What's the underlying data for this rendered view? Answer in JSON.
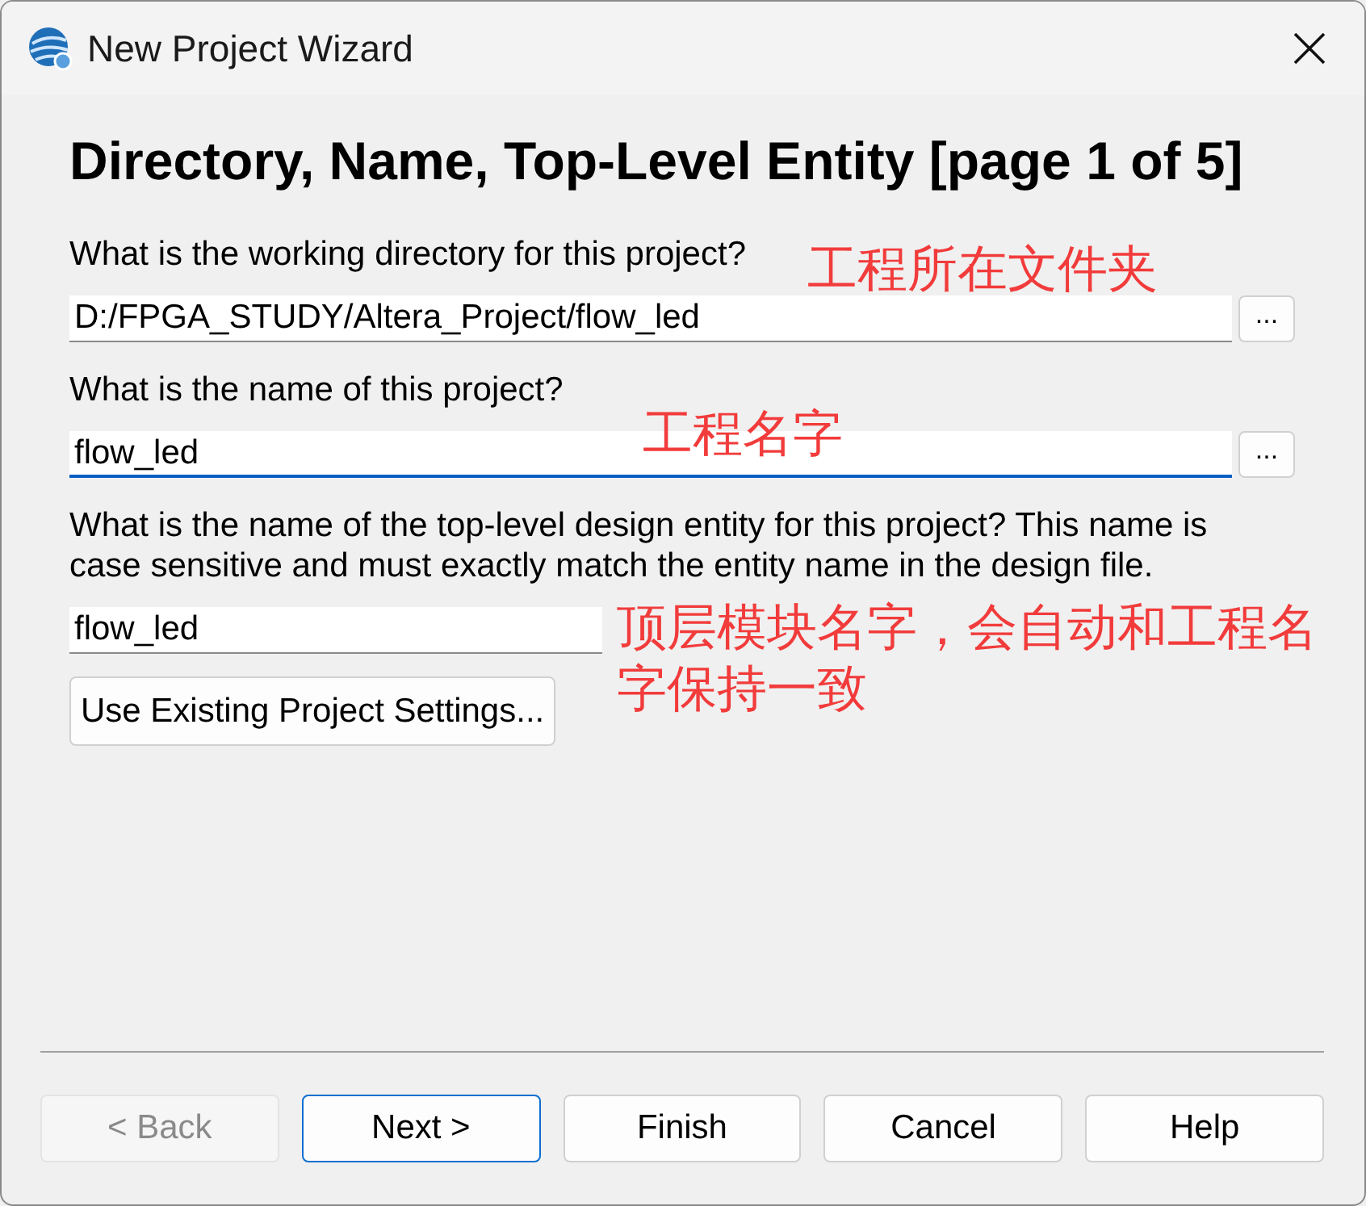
{
  "window": {
    "title": "New Project Wizard"
  },
  "heading": "Directory, Name, Top-Level Entity [page 1 of 5]",
  "fields": [
    {
      "label": "What is the working directory for this project?",
      "value": "D:/FPGA_STUDY/Altera_Project/flow_led",
      "focused": false,
      "browse": "..."
    },
    {
      "label": "What is the name of this project?",
      "value": "flow_led",
      "focused": true,
      "browse": "..."
    },
    {
      "label": "What is the name of the top-level design entity for this project? This name is case sensitive and must exactly match the entity name in the design file.",
      "value": "flow_led",
      "focused": false
    }
  ],
  "settings_button": "Use Existing Project Settings...",
  "annotations": [
    "工程所在文件夹",
    "工程名字",
    "顶层模块名字，会自动和工程名字保持一致"
  ],
  "buttons": [
    {
      "label": "< Back",
      "disabled": true,
      "default": false
    },
    {
      "label": "Next >",
      "disabled": false,
      "default": true
    },
    {
      "label": "Finish",
      "disabled": false,
      "default": false
    },
    {
      "label": "Cancel",
      "disabled": false,
      "default": false
    },
    {
      "label": "Help",
      "disabled": false,
      "default": false
    }
  ]
}
